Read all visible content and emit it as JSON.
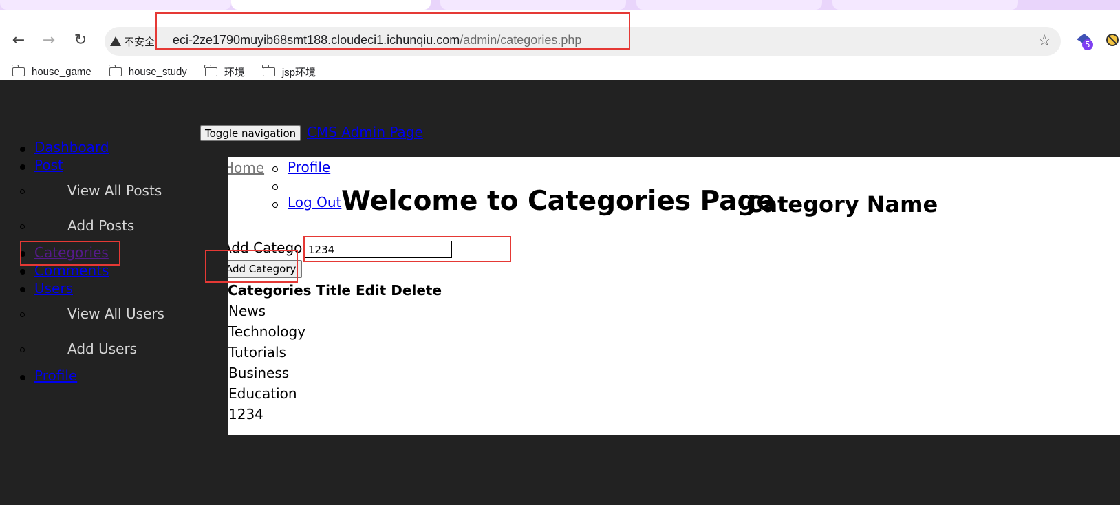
{
  "browser": {
    "security_label": "不安全",
    "url_host": "eci-2ze1790muyib68smt188.cloudeci1.ichunqiu.com",
    "url_path": "/admin/categories.php",
    "extension_badge": "5",
    "bookmarks": [
      "house_game",
      "house_study",
      "环境",
      "jsp环境"
    ]
  },
  "topnav": {
    "toggle_label": "Toggle navigation",
    "brand": "CMS Admin Page"
  },
  "sidebar": {
    "dashboard": "Dashboard",
    "post": "Post",
    "view_all_posts": "View All Posts",
    "add_posts": "Add Posts",
    "categories": "Categories",
    "comments": "Comments",
    "users": "Users",
    "view_all_users": "View All Users",
    "add_users": "Add Users",
    "profile": "Profile"
  },
  "main": {
    "home_link": "Home",
    "profile_link": "Profile",
    "logout_link": "Log Out",
    "heading": "Welcome to Categories Page",
    "subheading": "Category Name",
    "add_label": "Add Category",
    "input_value": "1234",
    "add_button": "Add Category",
    "table_header": "Categories Title Edit Delete",
    "rows": [
      "News",
      "Technology",
      "Tutorials",
      "Business",
      "Education",
      "1234"
    ]
  },
  "colors": {
    "page_bg": "#222222",
    "link": "#0000ee",
    "visited_link": "#551a8b",
    "highlight": "#e53935"
  }
}
